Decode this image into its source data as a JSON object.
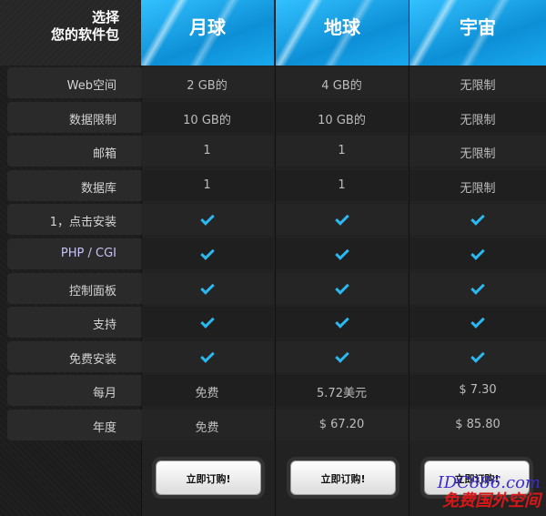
{
  "corner": {
    "line1": "选择",
    "line2": "您的软件包"
  },
  "plans": [
    {
      "name": "月球"
    },
    {
      "name": "地球"
    },
    {
      "name": "宇宙"
    }
  ],
  "rows": [
    {
      "label": "Web空间",
      "values": [
        "2 GB的",
        "4 GB的",
        "无限制"
      ]
    },
    {
      "label": "数据限制",
      "values": [
        "10 GB的",
        "10 GB的",
        "无限制"
      ]
    },
    {
      "label": "邮箱",
      "values": [
        "1",
        "1",
        "无限制"
      ]
    },
    {
      "label": "数据库",
      "values": [
        "1",
        "1",
        "无限制"
      ]
    },
    {
      "label": "1，点击安装",
      "values": [
        "check",
        "check",
        "check"
      ]
    },
    {
      "label": "PHP / CGI",
      "values": [
        "check",
        "check",
        "check"
      ]
    },
    {
      "label": "控制面板",
      "values": [
        "check",
        "check",
        "check"
      ]
    },
    {
      "label": "支持",
      "values": [
        "check",
        "check",
        "check"
      ]
    },
    {
      "label": "免费安装",
      "values": [
        "check",
        "check",
        "check"
      ]
    },
    {
      "label": "每月",
      "values": [
        "免费",
        "5.72美元",
        "$ 7.30"
      ]
    },
    {
      "label": "年度",
      "values": [
        "免费",
        "$ 67.20",
        "$ 85.80"
      ]
    }
  ],
  "order_button_label": "立即订购!",
  "watermark": {
    "url": "IDC886.com",
    "text": "免费国外空间"
  },
  "colors": {
    "header_blue": "#18a6e8",
    "check_blue": "#2ab8f0",
    "watermark_red": "#d81818"
  }
}
